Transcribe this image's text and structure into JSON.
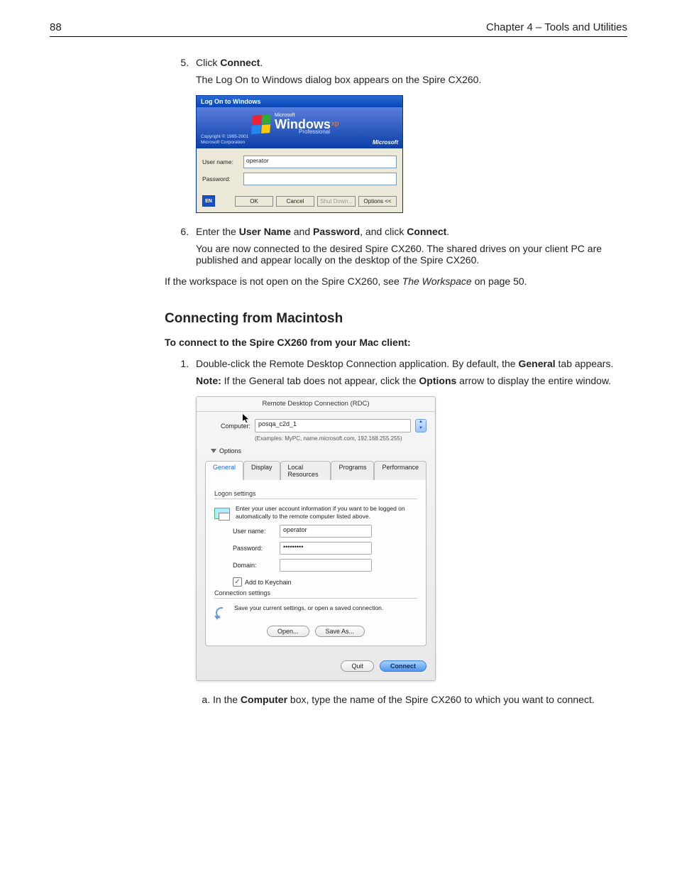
{
  "header": {
    "page_number": "88",
    "chapter": "Chapter 4 – Tools and Utilities"
  },
  "steps": {
    "five_a": "Click ",
    "five_b": "Connect",
    "five_c": ".",
    "five_desc": "The Log On to Windows dialog box appears on the Spire CX260.",
    "six_a": "Enter the ",
    "six_b": "User Name",
    "six_c": " and ",
    "six_d": "Password",
    "six_e": ", and click ",
    "six_f": "Connect",
    "six_g": ".",
    "six_desc": "You are now connected to the desired Spire CX260. The shared drives on your client PC are published and appear locally on the desktop of the Spire CX260.",
    "post_a": "If the workspace is not open on the Spire CX260, see ",
    "post_i": "The Workspace",
    "post_b": " on page 50."
  },
  "section_heading": "Connecting from Macintosh",
  "lead": "To connect to the Spire CX260 from your Mac client:",
  "mac_step1_a": "Double-click the Remote Desktop Connection application. By default, the ",
  "mac_step1_b": "General",
  "mac_step1_c": " tab appears.",
  "mac_note_a": "Note:",
  "mac_note_b": "  If the General tab does not appear, click the ",
  "mac_note_c": "Options",
  "mac_note_d": " arrow to display the entire window.",
  "sub_a_a": "In the ",
  "sub_a_b": "Computer",
  "sub_a_c": " box, type the name of the Spire CX260 to which you want to connect.",
  "win": {
    "title": "Log On to Windows",
    "copyright_line1": "Copyright © 1985-2001",
    "copyright_line2": "Microsoft Corporation",
    "logo_ms": "Microsoft",
    "logo_main": "Windows",
    "logo_xp": "xp",
    "logo_prof": "Professional",
    "ms_brand": "Microsoft",
    "lbl_user": "User name:",
    "lbl_pass": "Password:",
    "val_user": "operator",
    "lang": "EN",
    "btn_ok": "OK",
    "btn_cancel": "Cancel",
    "btn_shut": "Shut Down...",
    "btn_opts": "Options <<"
  },
  "mac": {
    "title": "Remote Desktop Connection (RDC)",
    "lbl_computer": "Computer:",
    "val_computer": "posqa_c2d_1",
    "hint": "(Examples: MyPC, name.microsoft.com, 192.168.255.255)",
    "options_toggle": "Options",
    "tabs": {
      "general": "General",
      "display": "Display",
      "local": "Local Resources",
      "programs": "Programs",
      "performance": "Performance"
    },
    "logon_label": "Logon settings",
    "logon_text": "Enter your user account information if you want to be logged on automatically to the remote computer listed above.",
    "lbl_user": "User name:",
    "val_user": "operator",
    "lbl_pass": "Password:",
    "val_pass": "•••••••••",
    "lbl_domain": "Domain:",
    "chk_keychain": "Add to Keychain",
    "conn_label": "Connection settings",
    "conn_text": "Save your current settings, or open a saved connection.",
    "btn_open": "Open...",
    "btn_saveas": "Save As...",
    "btn_quit": "Quit",
    "btn_connect": "Connect"
  }
}
